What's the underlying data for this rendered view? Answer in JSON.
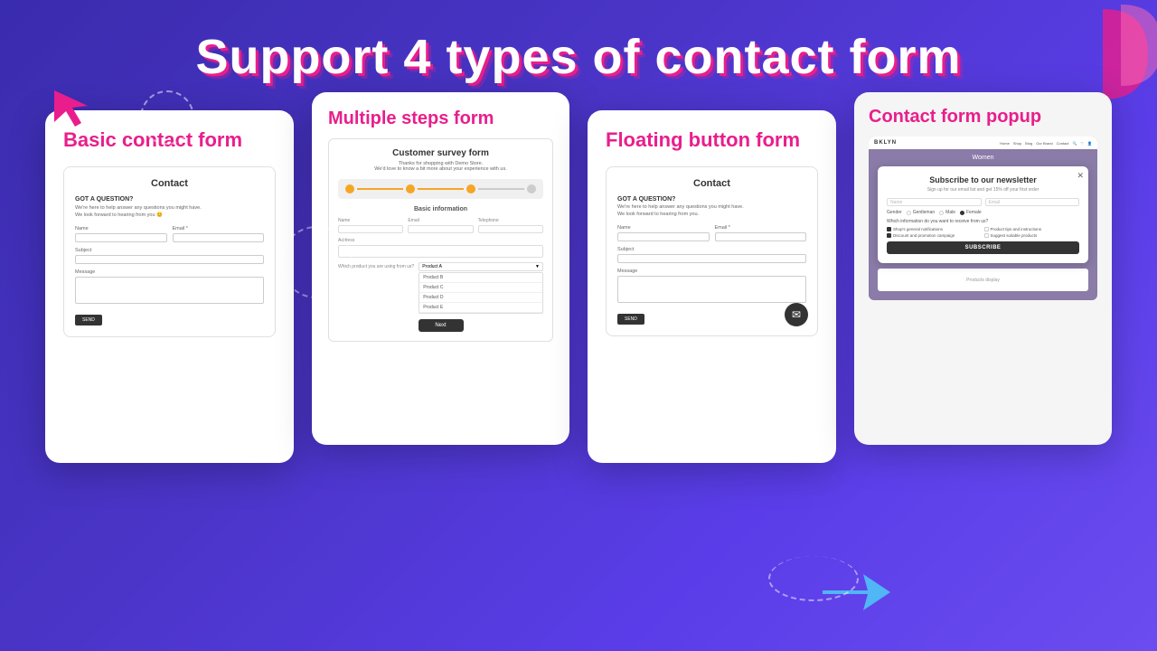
{
  "page": {
    "title": "Support 4 types of contact form",
    "background": "#4b35c9"
  },
  "cards": [
    {
      "id": "basic-contact",
      "title": "Basic contact form",
      "form": {
        "header": "Contact",
        "section_label": "GOT A QUESTION?",
        "section_desc": "We're here to help answer any questions you might have.\nWe look forward to hearing from you 😊",
        "fields": [
          {
            "label": "Name",
            "type": "text"
          },
          {
            "label": "Email *",
            "type": "text"
          },
          {
            "label": "Subject",
            "type": "text"
          },
          {
            "label": "Message",
            "type": "textarea"
          }
        ],
        "submit_btn": "SEND"
      }
    },
    {
      "id": "multiple-steps",
      "title": "Multiple steps form",
      "form": {
        "survey_title": "Customer survey form",
        "survey_desc": "Thanks for shopping with Demo Store.\nWe'd love to know a bit more about your experience with us.",
        "steps": [
          "Step 1",
          "Step 2",
          "Step 3",
          "Step 4"
        ],
        "current_step": 0,
        "section": "Basic information",
        "fields": [
          {
            "label": "Name",
            "type": "text"
          },
          {
            "label": "Email",
            "type": "text"
          },
          {
            "label": "Telephone",
            "type": "text"
          },
          {
            "label": "Address",
            "type": "text",
            "full": true
          }
        ],
        "product_label": "Which product you are using from us?",
        "product_selected": "Product A",
        "products": [
          "Product A",
          "Product B",
          "Product C",
          "Product D",
          "Product E"
        ],
        "next_btn": "Next"
      }
    },
    {
      "id": "floating-button",
      "title": "Floating button form",
      "form": {
        "header": "Contact",
        "section_label": "GOT A QUESTION?",
        "section_desc": "We're here to help answer any questions you might have.\nWe look forward to hearing from you.",
        "fields": [
          {
            "label": "Name",
            "type": "text"
          },
          {
            "label": "Email *",
            "type": "text"
          },
          {
            "label": "Subject",
            "type": "text"
          },
          {
            "label": "Message",
            "type": "textarea"
          }
        ],
        "submit_btn": "SEND",
        "floating_icon": "✉"
      }
    },
    {
      "id": "contact-popup",
      "title": "Contact form popup",
      "website": {
        "logo": "BKLYN",
        "nav": [
          "Home",
          "Shop",
          "Blog",
          "Our Brand",
          "Contact",
          "🔍",
          "♡",
          "👤"
        ],
        "page_heading": "Women"
      },
      "popup": {
        "title": "Subscribe to our newsletter",
        "desc": "Sign up for our email list and get 15% off your first order",
        "fields": [
          {
            "placeholder": "Name",
            "type": "text"
          },
          {
            "placeholder": "Email",
            "type": "text"
          }
        ],
        "gender_label": "Gender",
        "gender_options": [
          "Gentleman",
          "Male",
          "Female"
        ],
        "gender_selected": "Female",
        "info_label": "Which information do you want to receive from us?",
        "checkboxes": [
          {
            "label": "Shop's general notifications",
            "checked": true
          },
          {
            "label": "Product tips and instructions",
            "checked": false
          },
          {
            "label": "Discount and promotion campaign",
            "checked": true
          },
          {
            "label": "Suggest suitable products",
            "checked": false
          }
        ],
        "subscribe_btn": "SUBSCRIBE",
        "close_icon": "✕"
      }
    }
  ]
}
